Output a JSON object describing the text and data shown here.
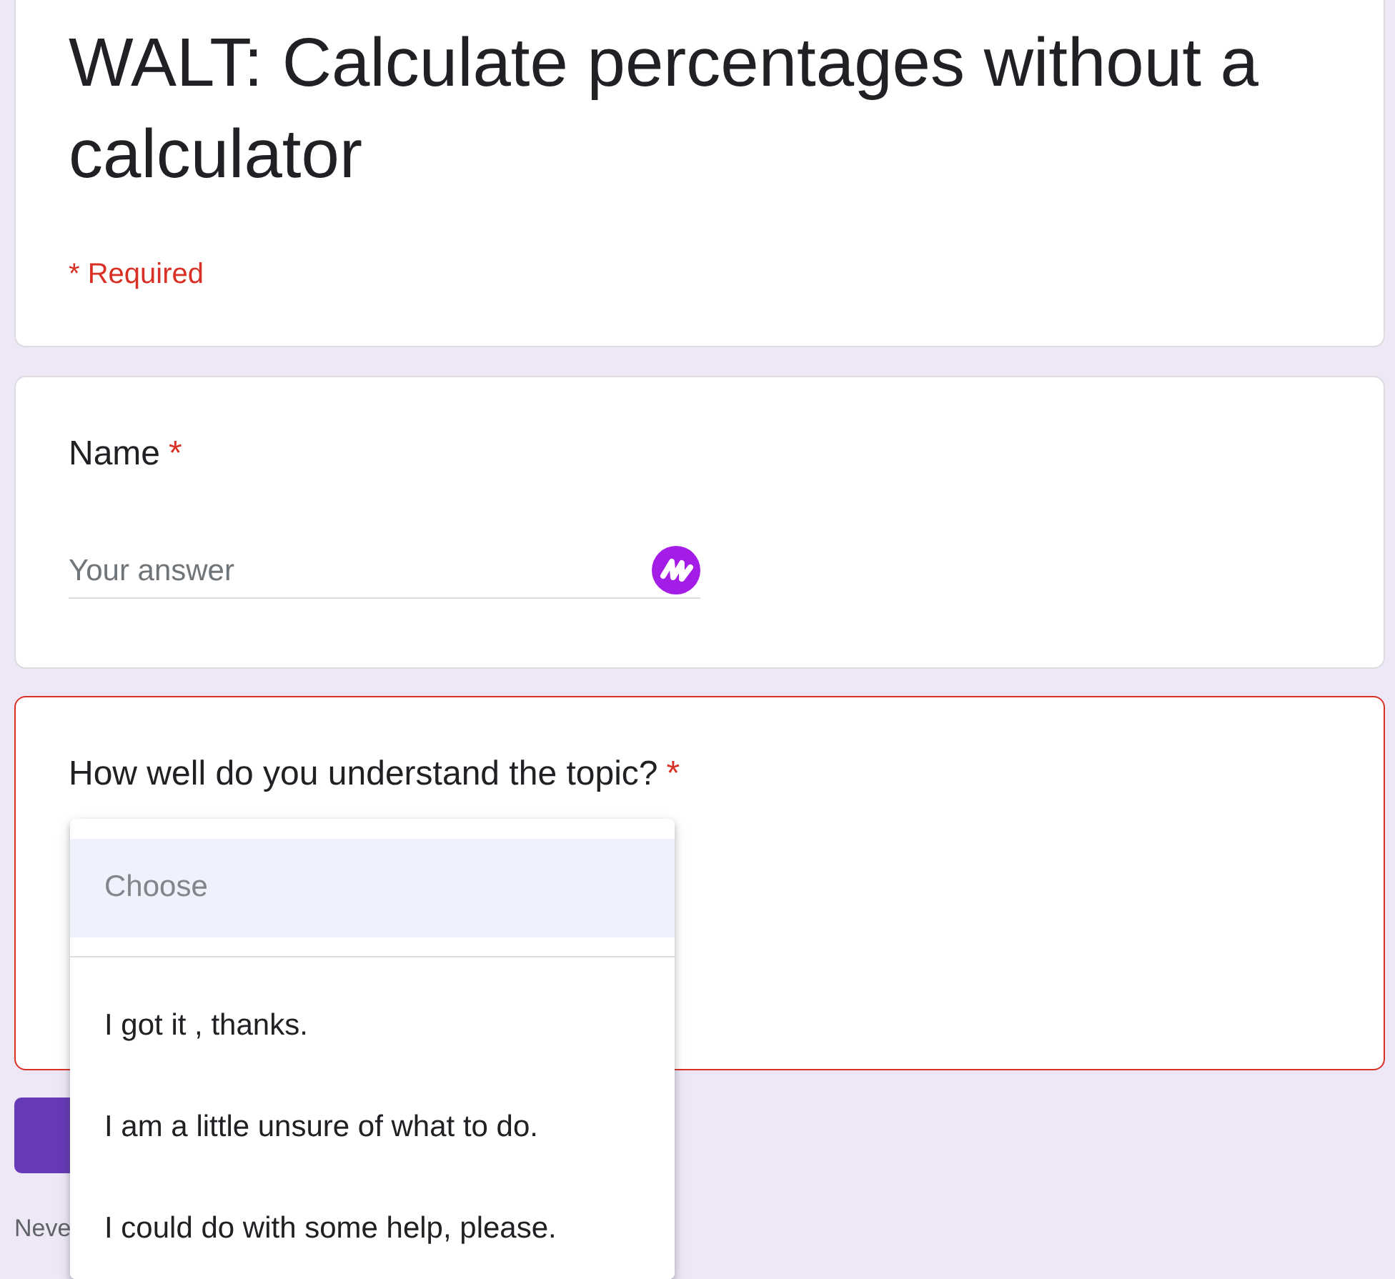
{
  "form": {
    "title": "WALT: Calculate percentages without a calculator",
    "required_note": "* Required"
  },
  "questions": [
    {
      "kind": "text",
      "label": "Name",
      "required_mark": "*",
      "error": false,
      "placeholder": "Your answer"
    },
    {
      "kind": "dropdown",
      "label": "How well do you understand the topic?",
      "required_mark": "*",
      "error": true,
      "menu": {
        "open": true,
        "options": [
          {
            "kind": "placeholder",
            "label": "Choose",
            "selected": true
          },
          {
            "kind": "option",
            "label": "I got it , thanks.",
            "selected": false
          },
          {
            "kind": "option",
            "label": "I am a little unsure of what to do.",
            "selected": false
          },
          {
            "kind": "option",
            "label": "I could do with some help, please.",
            "selected": false
          }
        ]
      }
    }
  ],
  "submit_button": {
    "kind": "primary"
  },
  "footer": {
    "note": "Neve"
  }
}
